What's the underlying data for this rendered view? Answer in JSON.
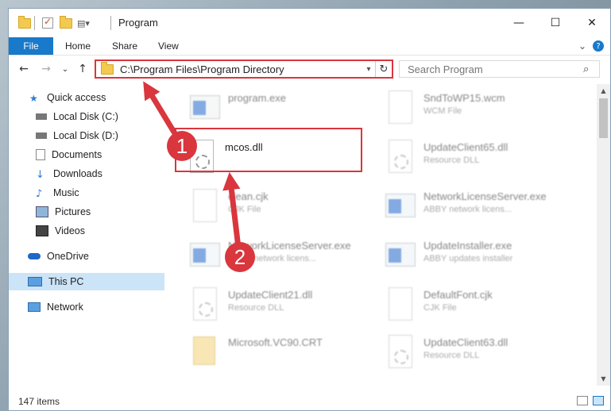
{
  "window": {
    "title": "Program"
  },
  "title_controls": {
    "minimize": "—",
    "maximize": "☐",
    "close": "✕"
  },
  "ribbon": {
    "tabs": [
      "File",
      "Home",
      "Share",
      "View"
    ],
    "expand": "⌄",
    "help": "?"
  },
  "nav": {
    "back": "←",
    "forward": "→",
    "recent": "⌄",
    "up": "↑",
    "address": "C:\\Program Files\\Program Directory",
    "address_dropdown": "▾",
    "refresh": "↻",
    "search_placeholder": "Search Program"
  },
  "sidebar": {
    "items": [
      {
        "label": "Quick access",
        "icon": "star-icon",
        "pinned": false
      },
      {
        "label": "Local Disk (C:)",
        "icon": "drive-icon",
        "pinned": true
      },
      {
        "label": "Local Disk (D:)",
        "icon": "drive-icon",
        "pinned": true
      },
      {
        "label": "Documents",
        "icon": "documents-icon",
        "pinned": true
      },
      {
        "label": "Downloads",
        "icon": "download-icon",
        "pinned": true
      },
      {
        "label": "Music",
        "icon": "music-icon",
        "pinned": true
      },
      {
        "label": "Pictures",
        "icon": "pictures-icon",
        "pinned": true
      },
      {
        "label": "Videos",
        "icon": "videos-icon",
        "pinned": true
      },
      {
        "label": "OneDrive",
        "icon": "cloud-icon",
        "pinned": false
      },
      {
        "label": "This PC",
        "icon": "computer-icon",
        "pinned": false,
        "selected": true
      },
      {
        "label": "Network",
        "icon": "network-icon",
        "pinned": false
      }
    ],
    "pin_glyph": "📌"
  },
  "files": [
    {
      "name": "program.exe",
      "type": ""
    },
    {
      "name": "SndToWP15.wcm",
      "type": "WCM File"
    },
    {
      "name": "mcos.dll",
      "type": ""
    },
    {
      "name": "UpdateClient65.dll",
      "type": "Resource DLL"
    },
    {
      "name": "clean.cjk",
      "type": "CJK File"
    },
    {
      "name": "NetworkLicenseServer.exe",
      "type": "ABBY network licens..."
    },
    {
      "name": "NetworkLicenseServer.exe",
      "type": "ABBY network licens..."
    },
    {
      "name": "UpdateInstaller.exe",
      "type": "ABBY updates installer"
    },
    {
      "name": "UpdateClient21.dll",
      "type": "Resource DLL"
    },
    {
      "name": "DefaultFont.cjk",
      "type": "CJK File"
    },
    {
      "name": "Microsoft.VC90.CRT",
      "type": ""
    },
    {
      "name": "UpdateClient63.dll",
      "type": "Resource DLL"
    }
  ],
  "status": {
    "items_count": "147 items"
  },
  "annotations": {
    "step1": "1",
    "step2": "2",
    "color": "#d9363e"
  }
}
